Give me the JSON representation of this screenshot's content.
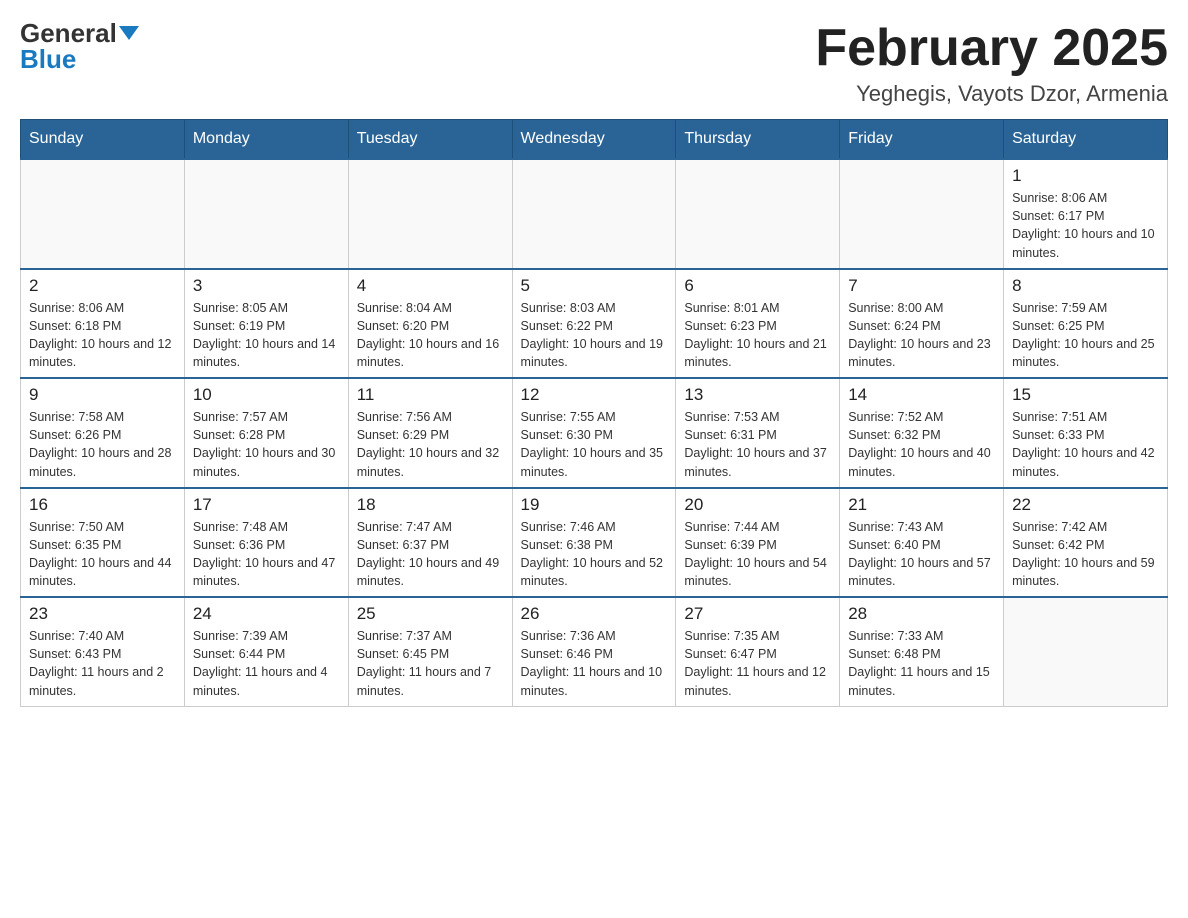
{
  "header": {
    "logo_general": "General",
    "logo_blue": "Blue",
    "month_title": "February 2025",
    "location": "Yeghegis, Vayots Dzor, Armenia"
  },
  "weekdays": [
    "Sunday",
    "Monday",
    "Tuesday",
    "Wednesday",
    "Thursday",
    "Friday",
    "Saturday"
  ],
  "weeks": [
    [
      {
        "day": "",
        "sunrise": "",
        "sunset": "",
        "daylight": ""
      },
      {
        "day": "",
        "sunrise": "",
        "sunset": "",
        "daylight": ""
      },
      {
        "day": "",
        "sunrise": "",
        "sunset": "",
        "daylight": ""
      },
      {
        "day": "",
        "sunrise": "",
        "sunset": "",
        "daylight": ""
      },
      {
        "day": "",
        "sunrise": "",
        "sunset": "",
        "daylight": ""
      },
      {
        "day": "",
        "sunrise": "",
        "sunset": "",
        "daylight": ""
      },
      {
        "day": "1",
        "sunrise": "Sunrise: 8:06 AM",
        "sunset": "Sunset: 6:17 PM",
        "daylight": "Daylight: 10 hours and 10 minutes."
      }
    ],
    [
      {
        "day": "2",
        "sunrise": "Sunrise: 8:06 AM",
        "sunset": "Sunset: 6:18 PM",
        "daylight": "Daylight: 10 hours and 12 minutes."
      },
      {
        "day": "3",
        "sunrise": "Sunrise: 8:05 AM",
        "sunset": "Sunset: 6:19 PM",
        "daylight": "Daylight: 10 hours and 14 minutes."
      },
      {
        "day": "4",
        "sunrise": "Sunrise: 8:04 AM",
        "sunset": "Sunset: 6:20 PM",
        "daylight": "Daylight: 10 hours and 16 minutes."
      },
      {
        "day": "5",
        "sunrise": "Sunrise: 8:03 AM",
        "sunset": "Sunset: 6:22 PM",
        "daylight": "Daylight: 10 hours and 19 minutes."
      },
      {
        "day": "6",
        "sunrise": "Sunrise: 8:01 AM",
        "sunset": "Sunset: 6:23 PM",
        "daylight": "Daylight: 10 hours and 21 minutes."
      },
      {
        "day": "7",
        "sunrise": "Sunrise: 8:00 AM",
        "sunset": "Sunset: 6:24 PM",
        "daylight": "Daylight: 10 hours and 23 minutes."
      },
      {
        "day": "8",
        "sunrise": "Sunrise: 7:59 AM",
        "sunset": "Sunset: 6:25 PM",
        "daylight": "Daylight: 10 hours and 25 minutes."
      }
    ],
    [
      {
        "day": "9",
        "sunrise": "Sunrise: 7:58 AM",
        "sunset": "Sunset: 6:26 PM",
        "daylight": "Daylight: 10 hours and 28 minutes."
      },
      {
        "day": "10",
        "sunrise": "Sunrise: 7:57 AM",
        "sunset": "Sunset: 6:28 PM",
        "daylight": "Daylight: 10 hours and 30 minutes."
      },
      {
        "day": "11",
        "sunrise": "Sunrise: 7:56 AM",
        "sunset": "Sunset: 6:29 PM",
        "daylight": "Daylight: 10 hours and 32 minutes."
      },
      {
        "day": "12",
        "sunrise": "Sunrise: 7:55 AM",
        "sunset": "Sunset: 6:30 PM",
        "daylight": "Daylight: 10 hours and 35 minutes."
      },
      {
        "day": "13",
        "sunrise": "Sunrise: 7:53 AM",
        "sunset": "Sunset: 6:31 PM",
        "daylight": "Daylight: 10 hours and 37 minutes."
      },
      {
        "day": "14",
        "sunrise": "Sunrise: 7:52 AM",
        "sunset": "Sunset: 6:32 PM",
        "daylight": "Daylight: 10 hours and 40 minutes."
      },
      {
        "day": "15",
        "sunrise": "Sunrise: 7:51 AM",
        "sunset": "Sunset: 6:33 PM",
        "daylight": "Daylight: 10 hours and 42 minutes."
      }
    ],
    [
      {
        "day": "16",
        "sunrise": "Sunrise: 7:50 AM",
        "sunset": "Sunset: 6:35 PM",
        "daylight": "Daylight: 10 hours and 44 minutes."
      },
      {
        "day": "17",
        "sunrise": "Sunrise: 7:48 AM",
        "sunset": "Sunset: 6:36 PM",
        "daylight": "Daylight: 10 hours and 47 minutes."
      },
      {
        "day": "18",
        "sunrise": "Sunrise: 7:47 AM",
        "sunset": "Sunset: 6:37 PM",
        "daylight": "Daylight: 10 hours and 49 minutes."
      },
      {
        "day": "19",
        "sunrise": "Sunrise: 7:46 AM",
        "sunset": "Sunset: 6:38 PM",
        "daylight": "Daylight: 10 hours and 52 minutes."
      },
      {
        "day": "20",
        "sunrise": "Sunrise: 7:44 AM",
        "sunset": "Sunset: 6:39 PM",
        "daylight": "Daylight: 10 hours and 54 minutes."
      },
      {
        "day": "21",
        "sunrise": "Sunrise: 7:43 AM",
        "sunset": "Sunset: 6:40 PM",
        "daylight": "Daylight: 10 hours and 57 minutes."
      },
      {
        "day": "22",
        "sunrise": "Sunrise: 7:42 AM",
        "sunset": "Sunset: 6:42 PM",
        "daylight": "Daylight: 10 hours and 59 minutes."
      }
    ],
    [
      {
        "day": "23",
        "sunrise": "Sunrise: 7:40 AM",
        "sunset": "Sunset: 6:43 PM",
        "daylight": "Daylight: 11 hours and 2 minutes."
      },
      {
        "day": "24",
        "sunrise": "Sunrise: 7:39 AM",
        "sunset": "Sunset: 6:44 PM",
        "daylight": "Daylight: 11 hours and 4 minutes."
      },
      {
        "day": "25",
        "sunrise": "Sunrise: 7:37 AM",
        "sunset": "Sunset: 6:45 PM",
        "daylight": "Daylight: 11 hours and 7 minutes."
      },
      {
        "day": "26",
        "sunrise": "Sunrise: 7:36 AM",
        "sunset": "Sunset: 6:46 PM",
        "daylight": "Daylight: 11 hours and 10 minutes."
      },
      {
        "day": "27",
        "sunrise": "Sunrise: 7:35 AM",
        "sunset": "Sunset: 6:47 PM",
        "daylight": "Daylight: 11 hours and 12 minutes."
      },
      {
        "day": "28",
        "sunrise": "Sunrise: 7:33 AM",
        "sunset": "Sunset: 6:48 PM",
        "daylight": "Daylight: 11 hours and 15 minutes."
      },
      {
        "day": "",
        "sunrise": "",
        "sunset": "",
        "daylight": ""
      }
    ]
  ]
}
